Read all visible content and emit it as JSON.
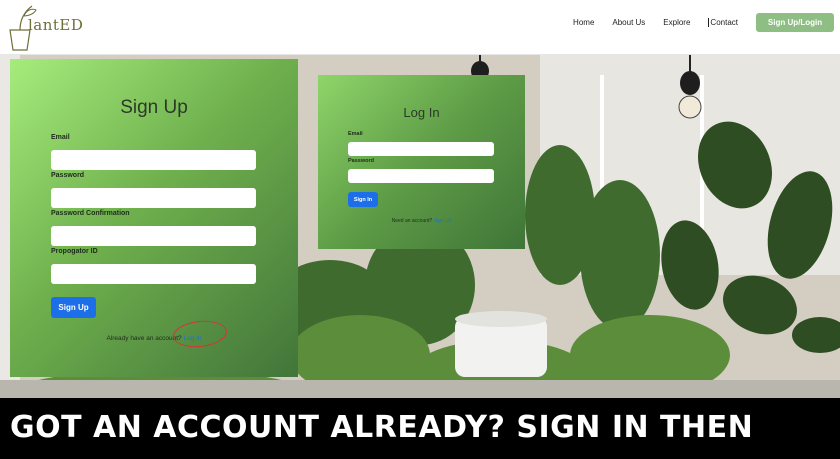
{
  "header": {
    "logo_text": "lantED",
    "nav": [
      "Home",
      "About Us",
      "Explore",
      "Contact"
    ],
    "cta_label": "Sign Up/Login"
  },
  "signup": {
    "title": "Sign Up",
    "fields": [
      "Email",
      "Password",
      "Password Confirmation",
      "Propogator ID"
    ],
    "button": "Sign Up",
    "footer_text": "Already have an account?",
    "footer_link": "Log In"
  },
  "login": {
    "title": "Log In",
    "fields": [
      "Email",
      "Password"
    ],
    "button": "Sign In",
    "footer_text": "Need an account?",
    "footer_link": "Sign Up"
  },
  "caption": "GOT AN ACCOUNT ALREADY? SIGN IN THEN",
  "colors": {
    "nav_button": "#8fbe84",
    "primary_button": "#1c6fe8",
    "form_green": "#6fb04d",
    "caption_bg": "#000000",
    "annotation_circle": "#d6333a"
  }
}
